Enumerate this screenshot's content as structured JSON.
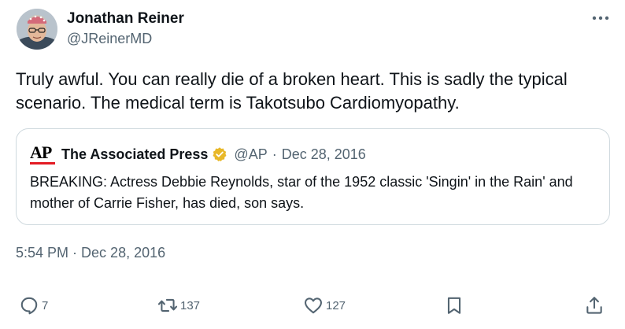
{
  "author": {
    "name": "Jonathan Reiner",
    "handle": "@JReinerMD"
  },
  "tweet": {
    "text": "Truly awful. You can really die of a broken heart. This is sadly the typical scenario. The medical term is Takotsubo Cardiomyopathy.",
    "time": "5:54 PM",
    "separator": "·",
    "date": "Dec 28, 2016"
  },
  "quote": {
    "logo_text": "AP",
    "name": "The Associated Press",
    "verified_icon": "gold-verified-badge-icon",
    "handle": "@AP",
    "separator": "·",
    "date": "Dec 28, 2016",
    "text": "BREAKING:  Actress Debbie Reynolds, star of the 1952 classic 'Singin' in the Rain' and mother of Carrie Fisher, has died, son says."
  },
  "actions": {
    "reply_count": "7",
    "retweet_count": "137",
    "like_count": "127"
  },
  "colors": {
    "text": "#0f1419",
    "secondary": "#536471",
    "border": "#cfd9de",
    "ap_red": "#e31b23",
    "verified_gold": "#e8b829"
  }
}
